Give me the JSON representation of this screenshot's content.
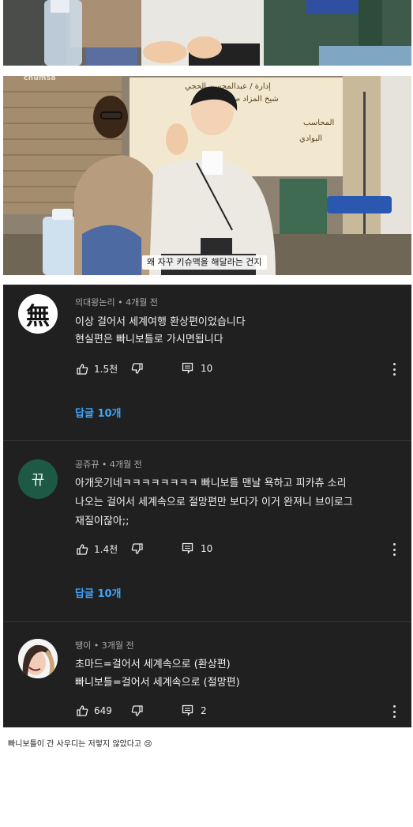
{
  "video": {
    "watermark": "chumsa",
    "subtitle": "왜 자꾸 키슈맥을 해달라는 건지",
    "sign_lines": [
      "إدارة / عبدالمحسن الحجي",
      "شيخ المزاد صالح الزهراني",
      "المحاسب",
      "البوادي"
    ]
  },
  "comments": [
    {
      "author": "의대왕논리",
      "time": "4개월 전",
      "avatar_text": "無",
      "lines": [
        "이상 걸어서 세계여행 환상편이었습니다",
        "현실편은 빠니보틀로 가시면됩니다"
      ],
      "likes": "1.5천",
      "reply_count": "10",
      "replies_label": "답글 10개"
    },
    {
      "author": "공쥬뀨",
      "time": "4개월 전",
      "avatar_text": "뀨",
      "lines": [
        "아개웃기네ㅋㅋㅋㅋㅋㅋㅋㅋ 빠니보틀 맨날 욕하고 피카츄 소리",
        "나오는 걸어서 세계속으로 절망편만 보다가 이거 완져니 브이로그",
        "재질이잖아;;"
      ],
      "likes": "1.4천",
      "reply_count": "10",
      "replies_label": "답글 10개"
    },
    {
      "author": "땡이",
      "time": "3개월 전",
      "avatar_text": "",
      "lines": [
        "초마드=걸어서 세계속으로 (환상편)",
        "빠니보틀=걸어서 세계속으로 (절망편)"
      ],
      "likes": "649",
      "reply_count": "2"
    }
  ],
  "caption": "빠니보틀이 간 사우디는 저렇지 않았다고 😢",
  "colors": {
    "bg": "#202020",
    "link": "#3ea6ff",
    "avatar2": "#1d5945"
  }
}
